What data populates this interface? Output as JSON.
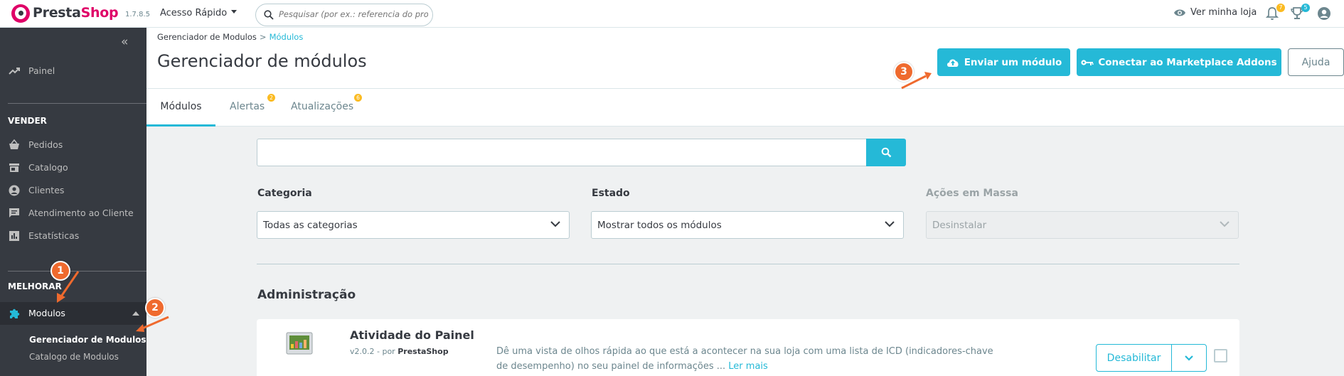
{
  "header": {
    "brand_presta": "Presta",
    "brand_shop": "Shop",
    "version": "1.7.8.5",
    "quick_access": "Acesso Rápido",
    "search_placeholder": "Pesquisar (por ex.: referencia do produto",
    "view_store": "Ver minha loja",
    "notifications_badge": "7",
    "trophy_badge": "5"
  },
  "sidebar": {
    "dashboard": "Painel",
    "sell_section": "VENDER",
    "orders": "Pedidos",
    "catalog": "Catalogo",
    "customers": "Clientes",
    "customer_service": "Atendimento ao Cliente",
    "stats": "Estatísticas",
    "improve_section": "MELHORAR",
    "modules": "Modulos",
    "sub_module_manager": "Gerenciador de Modulos",
    "sub_module_catalog": "Catalogo de Modulos"
  },
  "page": {
    "breadcrumb_parent": "Gerenciador de Modulos",
    "breadcrumb_sep": ">",
    "breadcrumb_current": "Módulos",
    "title": "Gerenciador de módulos",
    "upload_button": "Enviar um módulo",
    "connect_button": "Conectar ao Marketplace Addons",
    "help_button": "Ajuda"
  },
  "tabs": [
    {
      "label": "Módulos"
    },
    {
      "label": "Alertas",
      "badge": "2"
    },
    {
      "label": "Atualizações",
      "badge": "6"
    }
  ],
  "filters": {
    "category_label": "Categoria",
    "category_value": "Todas as categorias",
    "state_label": "Estado",
    "state_value": "Mostrar todos os módulos",
    "bulk_label": "Ações em Massa",
    "bulk_value": "Desinstalar"
  },
  "section": {
    "title": "Administração"
  },
  "module": {
    "name": "Atividade do Painel",
    "version": "v2.0.2 - por",
    "author": "PrestaShop",
    "description": "Dê uma vista de olhos rápida ao que está a acontecer na sua loja com uma lista de ICD (indicadores-chave de desempenho) no seu painel de informações ...",
    "read_more": "Ler mais",
    "disable_button": "Desabilitar"
  },
  "annotations": [
    "1",
    "2",
    "3"
  ],
  "colors": {
    "accent": "#25b9d7",
    "brand": "#df0067",
    "sidebar_bg": "#363a41",
    "annotation": "#ef6a2e"
  }
}
